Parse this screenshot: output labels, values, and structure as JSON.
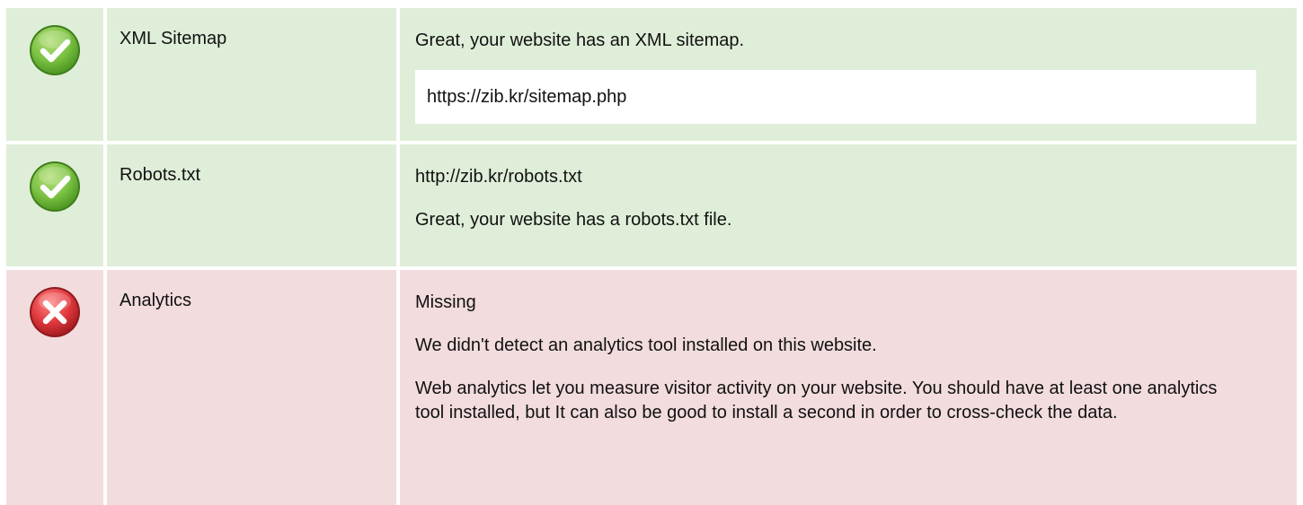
{
  "rows": [
    {
      "status": "pass",
      "icon": "check-icon",
      "name": "XML Sitemap",
      "lines": [
        "Great, your website has an XML sitemap."
      ],
      "url": "https://zib.kr/sitemap.php"
    },
    {
      "status": "pass",
      "icon": "check-icon",
      "name": "Robots.txt",
      "lines": [
        "http://zib.kr/robots.txt",
        "Great, your website has a robots.txt file."
      ]
    },
    {
      "status": "fail",
      "icon": "error-x-icon",
      "name": "Analytics",
      "lines": [
        "Missing",
        "We didn't detect an analytics tool installed on this website.",
        "Web analytics let you measure visitor activity on your website. You should have at least one analytics tool installed, but It can also be good to install a second in order to cross-check the data."
      ]
    }
  ],
  "colors": {
    "pass_bg": "#dfeed8",
    "fail_bg": "#f2dcdd",
    "check_green": "#7cc243",
    "error_red": "#e0393e"
  }
}
